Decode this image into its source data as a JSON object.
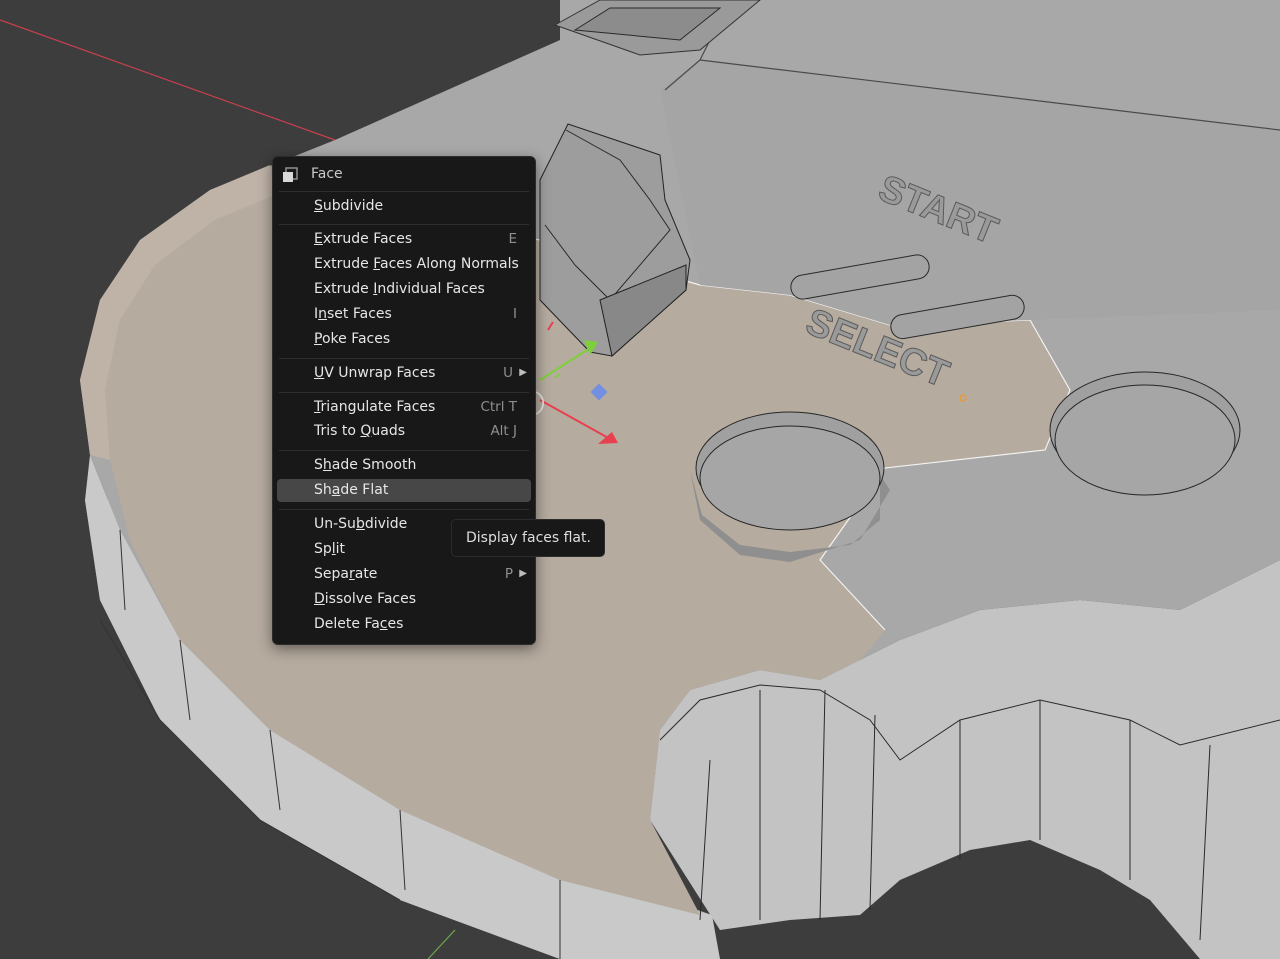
{
  "scene": {
    "labels": [
      "START",
      "SELECT"
    ],
    "colors": {
      "background": "#3d3d3d",
      "mesh_top": "#a7a7a7",
      "mesh_side": "#c4c4c4",
      "selected_face": "#b6ab9f",
      "wire": "#1c1c1c",
      "x_axis": "#c8404e",
      "gizmo_red": "#e8404e",
      "gizmo_green": "#7ed03a",
      "gizmo_blue": "#7390e0"
    }
  },
  "menu": {
    "title": "Face",
    "title_icon": "face-select-icon",
    "items": [
      {
        "pre": "",
        "u": "S",
        "post": "ubdivide",
        "shortcut": "",
        "submenu": false,
        "active": false
      },
      {
        "pre": "",
        "u": "E",
        "post": "xtrude Faces",
        "shortcut": "E",
        "submenu": false,
        "active": false
      },
      {
        "pre": "Extrude ",
        "u": "F",
        "post": "aces Along Normals",
        "shortcut": "",
        "submenu": false,
        "active": false
      },
      {
        "pre": "Extrude ",
        "u": "I",
        "post": "ndividual Faces",
        "shortcut": "",
        "submenu": false,
        "active": false
      },
      {
        "pre": "I",
        "u": "n",
        "post": "set Faces",
        "shortcut": "I",
        "submenu": false,
        "active": false
      },
      {
        "pre": "",
        "u": "P",
        "post": "oke Faces",
        "shortcut": "",
        "submenu": false,
        "active": false
      },
      {
        "pre": "",
        "u": "U",
        "post": "V Unwrap Faces",
        "shortcut": "U",
        "submenu": true,
        "active": false
      },
      {
        "pre": "",
        "u": "T",
        "post": "riangulate Faces",
        "shortcut": "Ctrl T",
        "submenu": false,
        "active": false
      },
      {
        "pre": "Tris to ",
        "u": "Q",
        "post": "uads",
        "shortcut": "Alt J",
        "submenu": false,
        "active": false
      },
      {
        "pre": "S",
        "u": "h",
        "post": "ade Smooth",
        "shortcut": "",
        "submenu": false,
        "active": false
      },
      {
        "pre": "Sh",
        "u": "a",
        "post": "de Flat",
        "shortcut": "",
        "submenu": false,
        "active": true
      },
      {
        "pre": "Un-Su",
        "u": "b",
        "post": "divide",
        "shortcut": "",
        "submenu": false,
        "active": false
      },
      {
        "pre": "Sp",
        "u": "l",
        "post": "it",
        "shortcut": "",
        "submenu": false,
        "active": false
      },
      {
        "pre": "Sepa",
        "u": "r",
        "post": "ate",
        "shortcut": "P",
        "submenu": true,
        "active": false
      },
      {
        "pre": "",
        "u": "D",
        "post": "issolve Faces",
        "shortcut": "",
        "submenu": false,
        "active": false
      },
      {
        "pre": "Delete Fa",
        "u": "c",
        "post": "es",
        "shortcut": "",
        "submenu": false,
        "active": false
      }
    ]
  },
  "tooltip": {
    "text": "Display faces flat."
  }
}
